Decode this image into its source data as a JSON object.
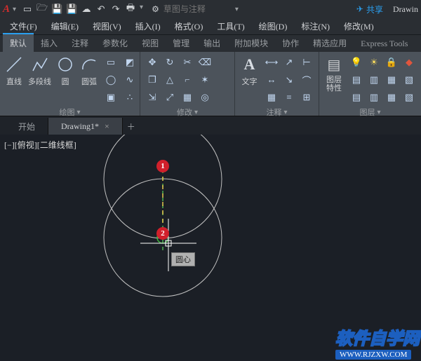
{
  "titlebar": {
    "search_placeholder": "草图与注释",
    "share": "共享",
    "app": "Drawin"
  },
  "menus": [
    "文件(F)",
    "编辑(E)",
    "视图(V)",
    "插入(I)",
    "格式(O)",
    "工具(T)",
    "绘图(D)",
    "标注(N)",
    "修改(M)"
  ],
  "ribbon_tabs": [
    "默认",
    "插入",
    "注释",
    "参数化",
    "视图",
    "管理",
    "输出",
    "附加模块",
    "协作",
    "精选应用",
    "Express Tools"
  ],
  "draw_panel": {
    "line": "直线",
    "pline": "多段线",
    "circle": "圆",
    "arc": "圆弧",
    "title": "绘图"
  },
  "modify_panel": {
    "title": "修改"
  },
  "annot_panel": {
    "text": "文字",
    "title": "注释"
  },
  "layer_panel": {
    "props": "图层\n特性",
    "title": "图层"
  },
  "doc_tabs": {
    "start": "开始",
    "drawing": "Drawing1*"
  },
  "canvas": {
    "viewport": "[−][俯视][二维线框]",
    "marker1": "1",
    "marker2": "2",
    "tooltip": "圆心"
  },
  "watermark": {
    "cn": "软件自学网",
    "en": "WWW.RJZXW.COM"
  }
}
